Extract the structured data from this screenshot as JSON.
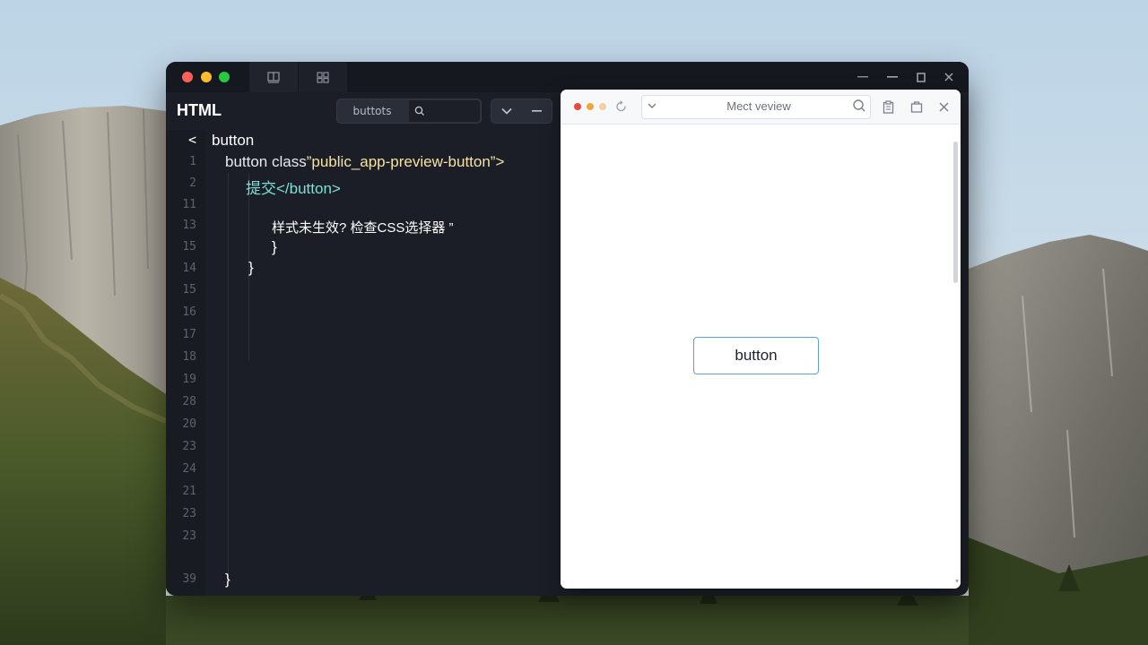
{
  "editor": {
    "file_title": "HTML",
    "search_chip": "buttots",
    "search_placeholder": "",
    "gutter": [
      "<",
      "1",
      "2",
      "11",
      "13",
      "15",
      "14",
      "15",
      "16",
      "17",
      "18",
      "19",
      "28",
      "20",
      "23",
      "24",
      "21",
      "23",
      "23",
      "39"
    ],
    "code": {
      "l0": "button",
      "l1_kw": "button class",
      "l1_str": "”public_app-preview-button”",
      "l1_end": ">",
      "l2_text": "提交",
      "l2_tag": "</button>",
      "l3_text": "样式未生效? 检查CSS选择器 ”",
      "l4": "}",
      "l5": "}",
      "l6": "}"
    }
  },
  "preview": {
    "url": "Mect veview",
    "button_label": "button"
  },
  "colors": {
    "editor_bg": "#1b1e26",
    "string": "#f6e3a1",
    "tag": "#7ee0d6",
    "button_border": "#5aa2d6"
  }
}
